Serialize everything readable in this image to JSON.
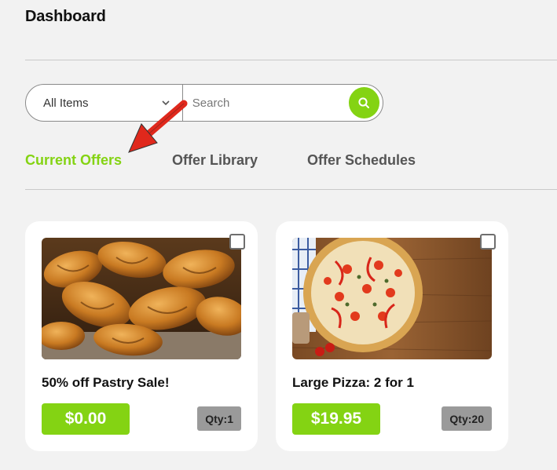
{
  "header": {
    "title": "Dashboard"
  },
  "search": {
    "filter_value": "All Items",
    "placeholder": "Search",
    "button_icon": "search-icon"
  },
  "tabs": [
    {
      "label": "Current Offers",
      "active": true
    },
    {
      "label": "Offer Library",
      "active": false
    },
    {
      "label": "Offer Schedules",
      "active": false
    }
  ],
  "offers": [
    {
      "title": "50% off Pastry Sale!",
      "price": "$0.00",
      "qty": "Qty:1",
      "image": "croissants-photo"
    },
    {
      "title": "Large Pizza: 2 for 1",
      "price": "$19.95",
      "qty": "Qty:20",
      "image": "pizza-photo"
    }
  ],
  "colors": {
    "accent": "#84d313",
    "annotation": "#e0281c"
  }
}
